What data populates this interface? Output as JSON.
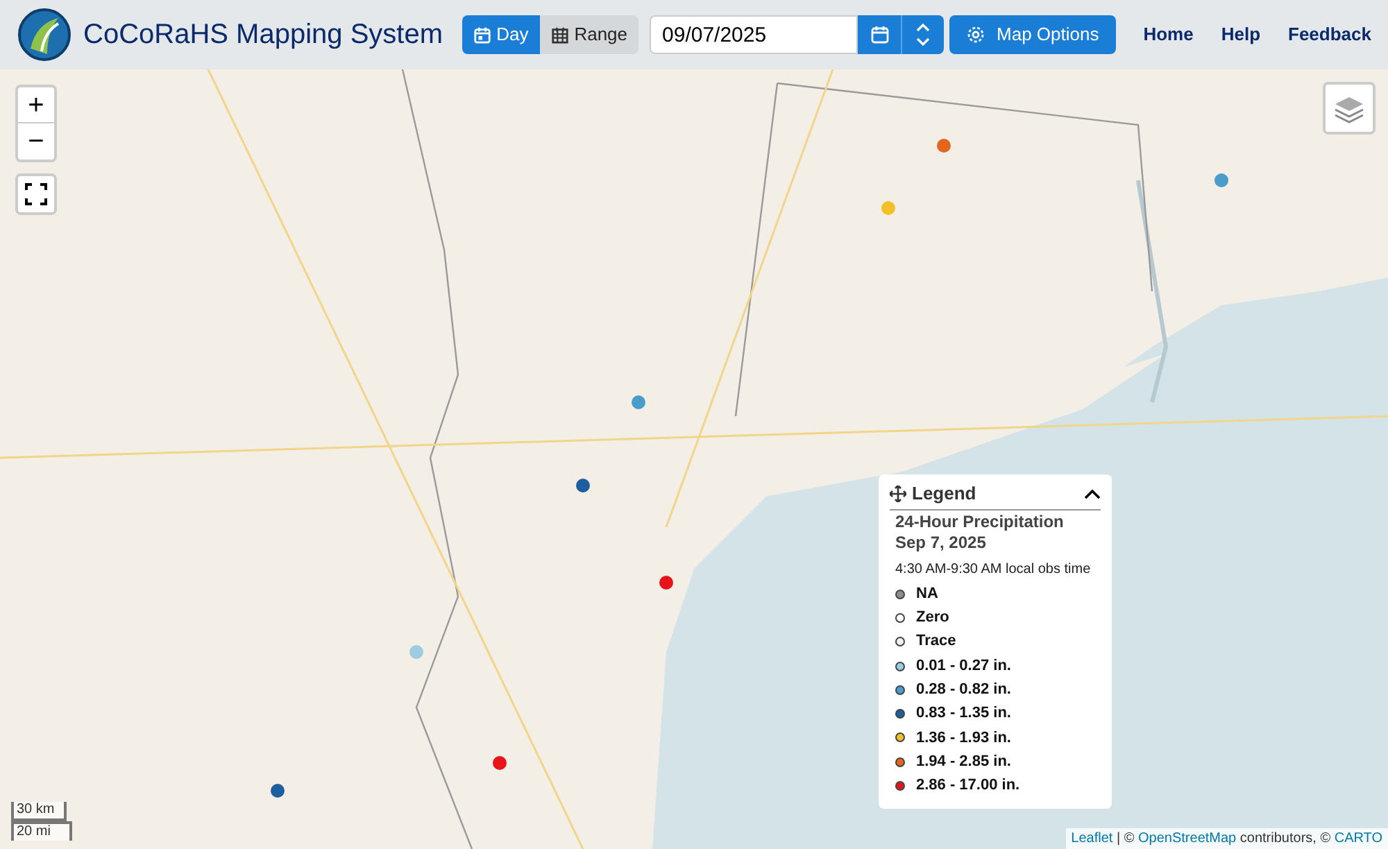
{
  "header": {
    "title": "CoCoRaHS Mapping System",
    "modes": [
      {
        "label": "Day",
        "selected": true
      },
      {
        "label": "Range",
        "selected": false
      }
    ],
    "date": {
      "value": "09/07/2025"
    },
    "map_options": "Map Options",
    "nav": [
      "Home",
      "Help",
      "Feedback"
    ]
  },
  "map": {
    "zoom_in": "+",
    "zoom_out": "−",
    "scale": [
      "30 km",
      "20 mi"
    ],
    "attribution": {
      "links": [
        "Leaflet",
        "OpenStreetMap",
        "CARTO"
      ],
      "separator": "|",
      "before_osm": "©",
      "after_osm": "contributors, ©"
    }
  },
  "legend": {
    "title": "Legend",
    "heading": "24-Hour Precipitation",
    "date": "Sep 7, 2025",
    "time": "4:30 AM-9:30 AM local obs time",
    "expanded": true,
    "items": [
      {
        "label": "NA",
        "color": "#8c8c8c"
      },
      {
        "label": "Zero",
        "color": "#ffffff"
      },
      {
        "label": "Trace",
        "color": "#eef2f5"
      },
      {
        "label": "0.01 - 0.27 in.",
        "color": "#9ccbe3"
      },
      {
        "label": "0.28 - 0.82 in.",
        "color": "#4a9ccb"
      },
      {
        "label": "0.83 - 1.35 in.",
        "color": "#1c5e9e"
      },
      {
        "label": "1.36 - 1.93 in.",
        "color": "#f4c027"
      },
      {
        "label": "1.94 - 2.85 in.",
        "color": "#e2661d"
      },
      {
        "label": "2.86 - 17.00 in.",
        "color": "#e8141c"
      }
    ]
  }
}
